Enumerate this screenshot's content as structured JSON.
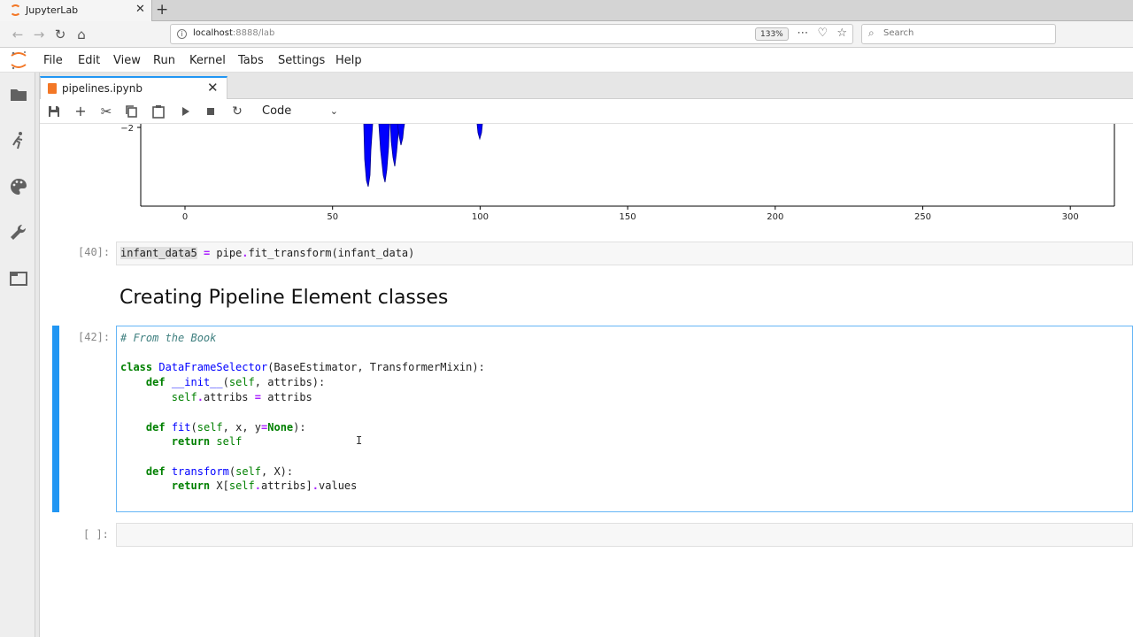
{
  "browser": {
    "tab_title": "JupyterLab",
    "url_host": "localhost",
    "url_path": ":8888/lab",
    "zoom": "133%",
    "search_placeholder": "Search"
  },
  "menu": [
    "File",
    "Edit",
    "View",
    "Run",
    "Kernel",
    "Tabs",
    "Settings",
    "Help"
  ],
  "notebook": {
    "tab_title": "pipelines.ipynb",
    "cell_type": "Code"
  },
  "plot": {
    "y_tick": "−2",
    "x_ticks": [
      "0",
      "50",
      "100",
      "150",
      "200",
      "250",
      "300"
    ],
    "bar_color": "#0000ff"
  },
  "cells": {
    "c40_prompt": "[40]:",
    "c42_prompt": "[42]:",
    "empty_prompt": "[ ]:",
    "heading": "Creating Pipeline Element classes"
  },
  "colors": {
    "accent": "#2196f3",
    "jupyter_orange": "#f37726"
  }
}
